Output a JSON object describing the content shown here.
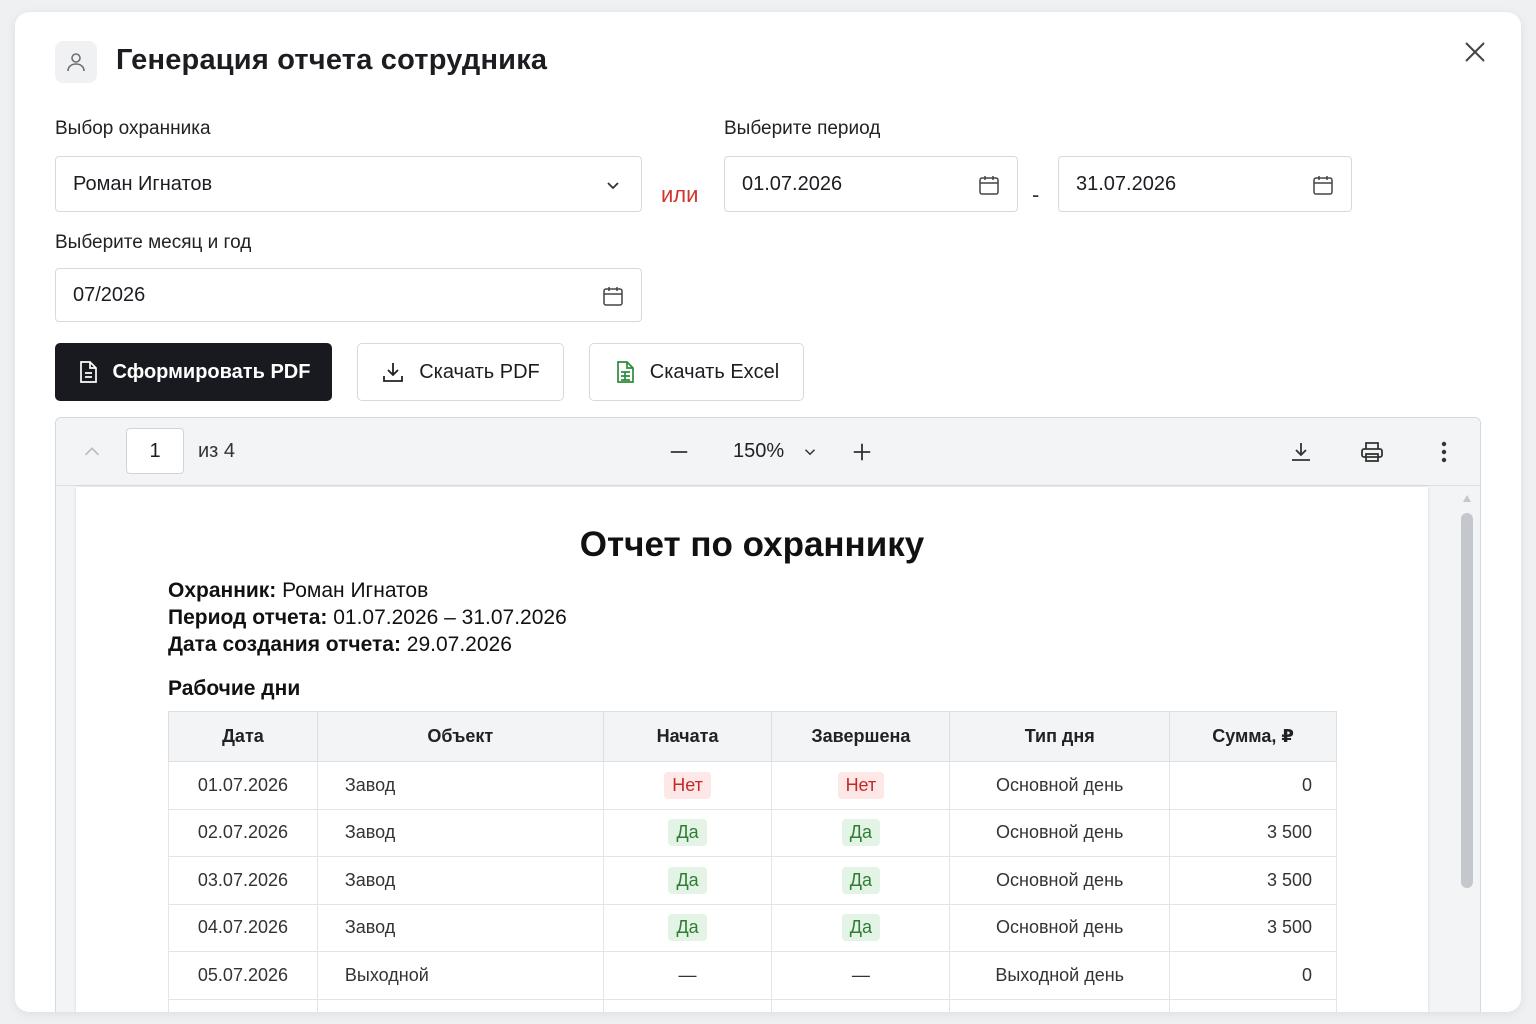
{
  "dialog": {
    "title": "Генерация отчета сотрудника",
    "icons": {
      "title": "user-icon",
      "close": "close-icon"
    }
  },
  "form": {
    "guard_label": "Выбор охранника",
    "guard_value": "Роман Игнатов",
    "or_text": "или",
    "period_label": "Выберите период",
    "period_from": "01.07.2026",
    "period_sep": "-",
    "period_to": "31.07.2026",
    "month_label": "Выберите месяц и год",
    "month_value": "07/2026"
  },
  "actions": {
    "generate_pdf": "Сформировать PDF",
    "download_pdf": "Скачать PDF",
    "download_excel": "Скачать Excel"
  },
  "viewer": {
    "current_page": "1",
    "page_of": "из 4",
    "zoom": "150%"
  },
  "report": {
    "title": "Отчет по охраннику",
    "guard_key": "Охранник:",
    "guard_val": "Роман Игнатов",
    "period_key": "Период отчета:",
    "period_val": "01.07.2026 – 31.07.2026",
    "created_key": "Дата создания отчета:",
    "created_val": "29.07.2026",
    "section": "Рабочие дни",
    "columns": [
      "Дата",
      "Объект",
      "Начата",
      "Завершена",
      "Тип дня",
      "Сумма, ₽"
    ],
    "rows": [
      {
        "date": "01.07.2026",
        "object": "Завод",
        "started": "Нет",
        "finished": "Нет",
        "type": "Основной день",
        "sum": "0"
      },
      {
        "date": "02.07.2026",
        "object": "Завод",
        "started": "Да",
        "finished": "Да",
        "type": "Основной день",
        "sum": "3 500"
      },
      {
        "date": "03.07.2026",
        "object": "Завод",
        "started": "Да",
        "finished": "Да",
        "type": "Основной день",
        "sum": "3 500"
      },
      {
        "date": "04.07.2026",
        "object": "Завод",
        "started": "Да",
        "finished": "Да",
        "type": "Основной день",
        "sum": "3 500"
      },
      {
        "date": "05.07.2026",
        "object": "Выходной",
        "started": "—",
        "finished": "—",
        "type": "Выходной день",
        "sum": "0"
      },
      {
        "date": "",
        "object": "",
        "started": "",
        "finished": "",
        "type": "",
        "sum": ""
      }
    ]
  },
  "colors": {
    "accent_dark": "#181a1f",
    "danger": "#d0342c",
    "yes_bg": "#e3f4e6",
    "yes_text": "#2e7d32",
    "no_bg": "#fde7e7",
    "no_text": "#c62828"
  }
}
